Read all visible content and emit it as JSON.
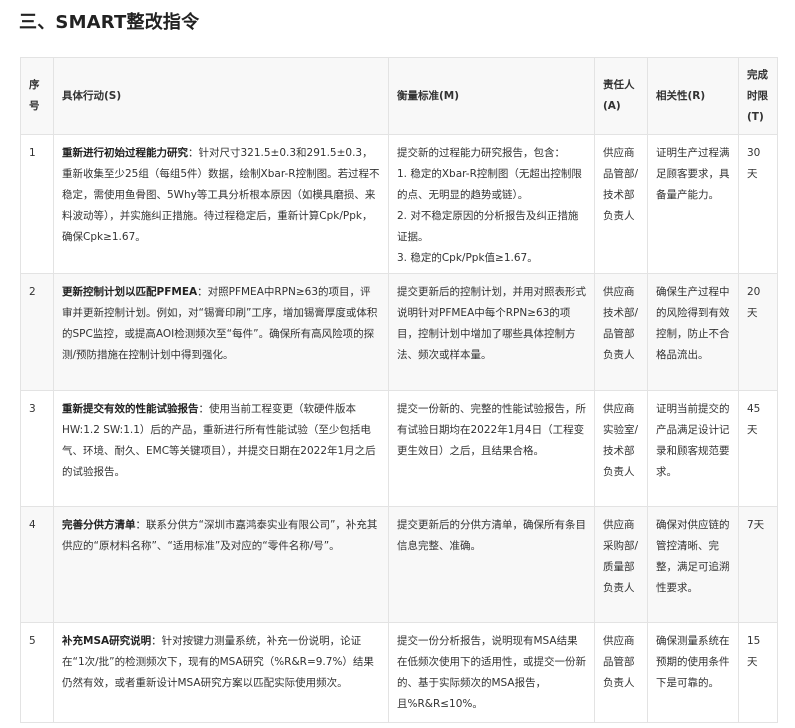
{
  "title": "三、SMART整改指令",
  "columns": {
    "no": "序号",
    "action": "具体行动(S)",
    "measure": "衡量标准(M)",
    "owner": "责任人(A)",
    "relevance": "相关性(R)",
    "deadline": "完成时限(T)"
  },
  "rows": [
    {
      "no": "1",
      "action_title": "重新进行初始过程能力研究",
      "action_text": "：针对尺寸321.5±0.3和291.5±0.3，重新收集至少25组（每组5件）数据，绘制Xbar-R控制图。若过程不稳定，需使用鱼骨图、5Why等工具分析根本原因（如模具磨损、来料波动等），并实施纠正措施。待过程稳定后，重新计算Cpk/Ppk，确保Cpk≥1.67。",
      "measure": [
        "提交新的过程能力研究报告，包含：",
        "1. 稳定的Xbar-R控制图（无超出控制限的点、无明显的趋势或链）。",
        "2. 对不稳定原因的分析报告及纠正措施证据。",
        "3. 稳定的Cpk/Ppk值≥1.67。"
      ],
      "owner": "供应商品管部/技术部负责人",
      "relevance": "证明生产过程满足顾客要求，具备量产能力。",
      "deadline": "30天"
    },
    {
      "no": "2",
      "action_title": "更新控制计划以匹配PFMEA",
      "action_text": "：对照PFMEA中RPN≥63的项目，评审并更新控制计划。例如，对“锡膏印刷”工序，增加锡膏厚度或体积的SPC监控，或提高AOI检测频次至“每件”。确保所有高风险项的探测/预防措施在控制计划中得到强化。",
      "measure": [
        "提交更新后的控制计划，并用对照表形式说明针对PFMEA中每个RPN≥63的项目，控制计划中增加了哪些具体控制方法、频次或样本量。"
      ],
      "owner": "供应商技术部/品管部负责人",
      "relevance": "确保生产过程中的风险得到有效控制，防止不合格品流出。",
      "deadline": "20天"
    },
    {
      "no": "3",
      "action_title": "重新提交有效的性能试验报告",
      "action_text": "：使用当前工程变更（软硬件版本HW:1.2 SW:1.1）后的产品，重新进行所有性能试验（至少包括电气、环境、耐久、EMC等关键项目），并提交日期在2022年1月之后的试验报告。",
      "measure": [
        "提交一份新的、完整的性能试验报告，所有试验日期均在2022年1月4日（工程变更生效日）之后，且结果合格。"
      ],
      "owner": "供应商实验室/技术部负责人",
      "relevance": "证明当前提交的产品满足设计记录和顾客规范要求。",
      "deadline": "45天"
    },
    {
      "no": "4",
      "action_title": "完善分供方清单",
      "action_text": "：联系分供方“深圳市嘉鸿泰实业有限公司”，补充其供应的“原材料名称”、“适用标准”及对应的“零件名称/号”。",
      "measure": [
        "提交更新后的分供方清单，确保所有条目信息完整、准确。"
      ],
      "owner": "供应商采购部/质量部负责人",
      "relevance": "确保对供应链的管控清晰、完整，满足可追溯性要求。",
      "deadline": "7天"
    },
    {
      "no": "5",
      "action_title": "补充MSA研究说明",
      "action_text": "：针对按键力测量系统，补充一份说明，论证在“1次/批”的检测频次下，现有的MSA研究（%R&R=9.7%）结果仍然有效，或者重新设计MSA研究方案以匹配实际使用频次。",
      "measure": [
        "提交一份分析报告，说明现有MSA结果在低频次使用下的适用性，或提交一份新的、基于实际频次的MSA报告，且%R&R≤10%。"
      ],
      "owner": "供应商品管部负责人",
      "relevance": "确保测量系统在预期的使用条件下是可靠的。",
      "deadline": "15天"
    }
  ]
}
